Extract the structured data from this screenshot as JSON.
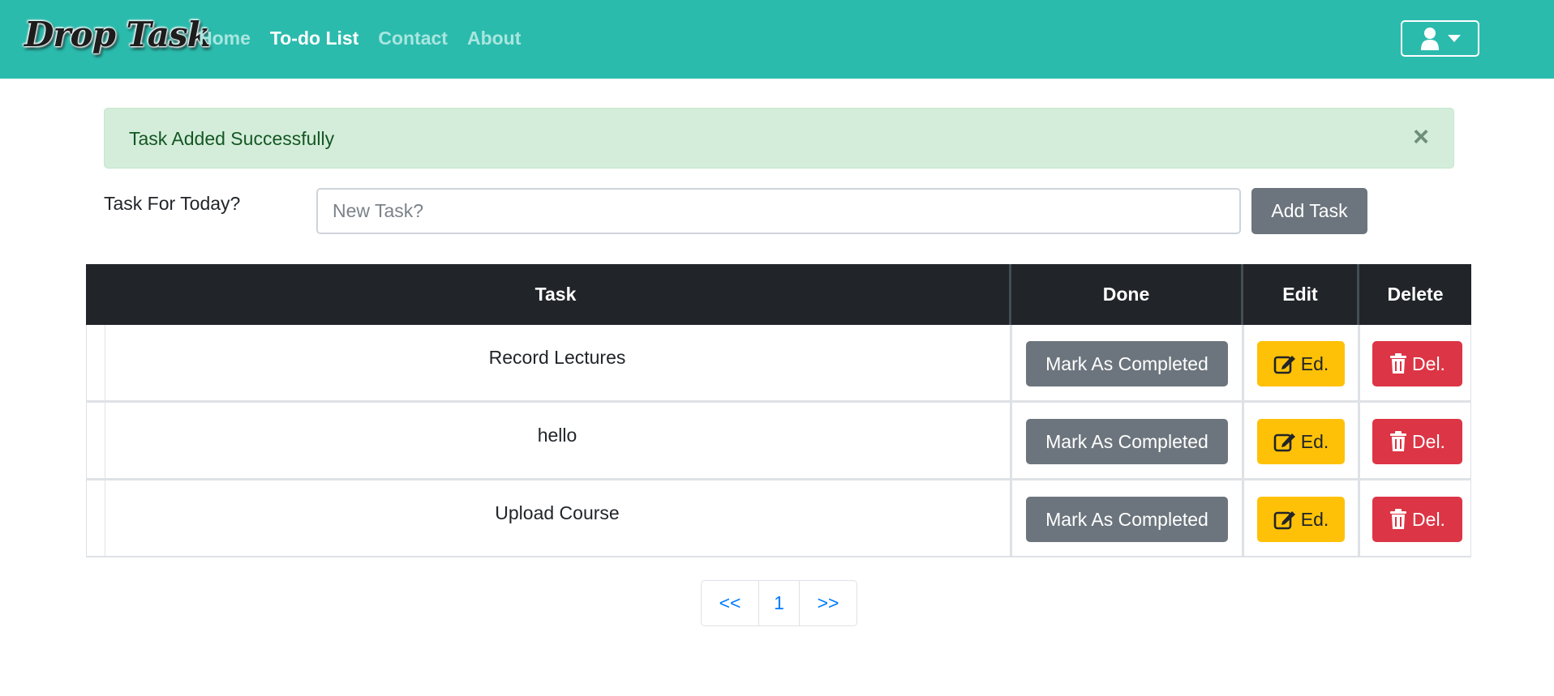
{
  "navbar": {
    "brand": "Drop Task",
    "links": [
      {
        "label": "Home",
        "active": false
      },
      {
        "label": "To-do List",
        "active": true
      },
      {
        "label": "Contact",
        "active": false
      },
      {
        "label": "About",
        "active": false
      }
    ],
    "user_menu_icon": "user-icon",
    "user_menu_caret": "caret-down-icon"
  },
  "alert": {
    "message": "Task Added Successfully",
    "close_glyph": "×"
  },
  "form": {
    "label": "Task For Today?",
    "input_placeholder": "New Task?",
    "input_value": "",
    "submit_label": "Add Task"
  },
  "table": {
    "headers": [
      "Task",
      "Done",
      "Edit",
      "Delete"
    ],
    "rows": [
      {
        "task": "Record Lectures",
        "done_label": "Mark As Completed",
        "edit_label": "Ed.",
        "delete_label": "Del."
      },
      {
        "task": "hello",
        "done_label": "Mark As Completed",
        "edit_label": "Ed.",
        "delete_label": "Del."
      },
      {
        "task": "Upload Course",
        "done_label": "Mark As Completed",
        "edit_label": "Ed.",
        "delete_label": "Del."
      }
    ]
  },
  "pagination": {
    "prev": "<<",
    "current": "1",
    "next": ">>"
  },
  "colors": {
    "navbar": "#2bbbad",
    "success_bg": "#d4edda",
    "secondary": "#6c757d",
    "warning": "#ffc107",
    "danger": "#dc3545",
    "dark": "#212529",
    "link": "#007bff"
  }
}
